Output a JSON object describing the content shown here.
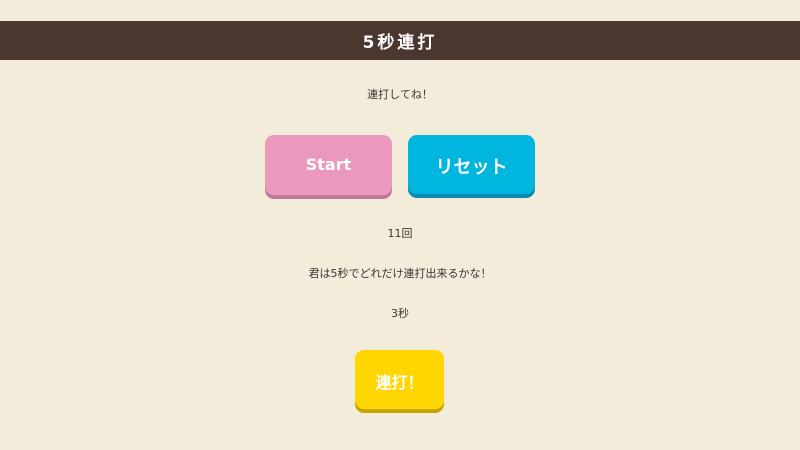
{
  "header": {
    "title": "5秒連打"
  },
  "instruction": "連打してね！",
  "buttons": {
    "start_label": "Start",
    "reset_label": "リセット",
    "tap_label": "連打！"
  },
  "status": {
    "count": "11回",
    "prompt": "君は5秒でどれだけ連打出来るかな！",
    "timer": "3秒"
  },
  "colors": {
    "background": "#f4ecdb",
    "header": "#4a3730",
    "start_button": "#eb98bd",
    "reset_button": "#00b6de",
    "tap_button": "#ffd600"
  }
}
